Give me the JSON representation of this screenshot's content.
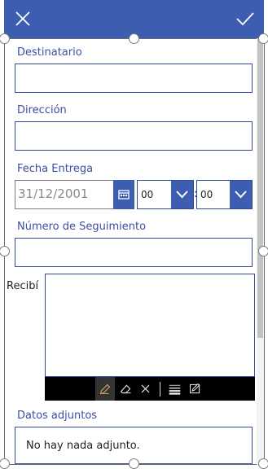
{
  "header": {
    "close_icon": "close-icon",
    "accept_icon": "checkmark-icon",
    "background": "#3c5db0"
  },
  "form": {
    "destinatario": {
      "label": "Destinatario",
      "value": ""
    },
    "direccion": {
      "label": "Dirección",
      "value": ""
    },
    "fecha_entrega": {
      "label": "Fecha Entrega",
      "date_placeholder": "31/12/2001",
      "calendar_icon": "calendar-icon",
      "hour_value": "00",
      "colon": ":",
      "minute_value": "00",
      "dropdown_icon": "chevron-down-icon"
    },
    "numero_seguimiento": {
      "label": "Número de Seguimiento",
      "value": ""
    },
    "recibi": {
      "label": "Recibí",
      "toolbar_tools": [
        "pen-icon",
        "eraser-icon",
        "clear-icon",
        "stroke-width-icon",
        "color-pen-icon"
      ]
    },
    "datos_adjuntos": {
      "label": "Datos adjuntos",
      "empty_text": "No hay nada adjunto."
    }
  },
  "colors": {
    "accent": "#3c5db0",
    "label": "#3c4fa5",
    "border": "#334a98"
  }
}
